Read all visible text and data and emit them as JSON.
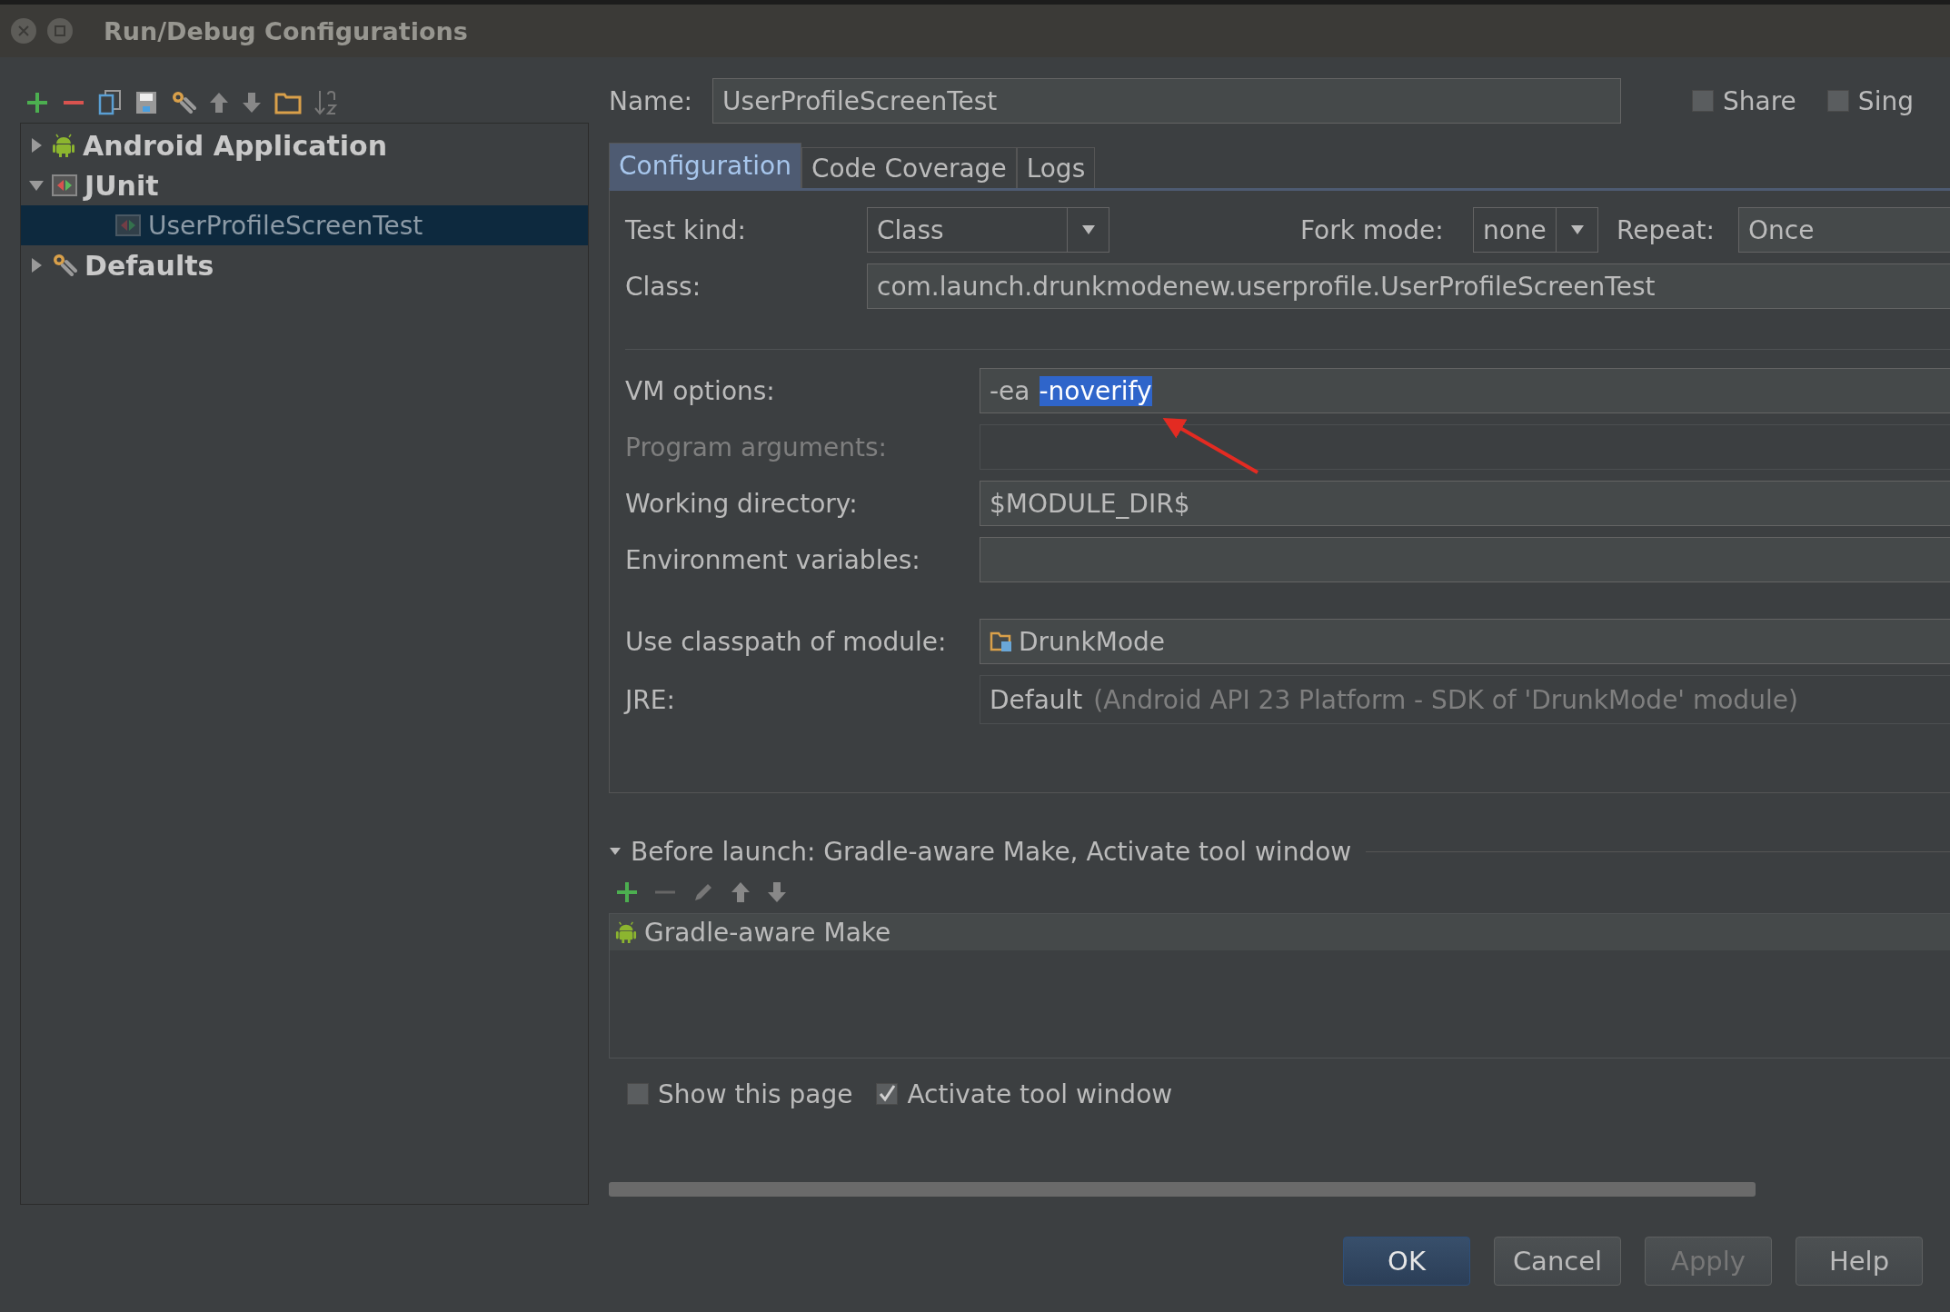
{
  "window": {
    "title": "Run/Debug Configurations"
  },
  "tree": [
    {
      "label": "Android Application",
      "kind": "android",
      "expanded": false,
      "selected": false
    },
    {
      "label": "JUnit",
      "kind": "junit",
      "expanded": true,
      "selected": false,
      "children": [
        {
          "label": "UserProfileScreenTest",
          "kind": "test",
          "selected": true
        }
      ]
    },
    {
      "label": "Defaults",
      "kind": "defaults",
      "expanded": false,
      "selected": false
    }
  ],
  "name_field": {
    "label": "Name:",
    "value": "UserProfileScreenTest"
  },
  "header_checkboxes": [
    {
      "label": "Share",
      "checked": false
    },
    {
      "label": "Sing",
      "checked": false
    }
  ],
  "tabs": [
    {
      "label": "Configuration",
      "selected": true
    },
    {
      "label": "Code Coverage",
      "selected": false
    },
    {
      "label": "Logs",
      "selected": false
    }
  ],
  "test_kind": {
    "label": "Test kind:",
    "value": "Class"
  },
  "fork_mode": {
    "label": "Fork mode:",
    "value": "none"
  },
  "repeat": {
    "label": "Repeat:",
    "value": "Once"
  },
  "class_field": {
    "label": "Class:",
    "value": "com.launch.drunkmodenew.userprofile.UserProfileScreenTest"
  },
  "options": [
    {
      "label": "VM options:",
      "value": "-ea",
      "selected_text": "-noverify",
      "disabled": false
    },
    {
      "label": "Program arguments:",
      "disabled": true
    },
    {
      "label": "Working directory:",
      "value": "$MODULE_DIR$",
      "disabled": false
    },
    {
      "label": "Environment variables:",
      "disabled": false
    }
  ],
  "classpath": {
    "label": "Use classpath of module:",
    "value": "DrunkMode"
  },
  "jre": {
    "label": "JRE:",
    "value": "Default",
    "hint": "(Android API 23 Platform - SDK of 'DrunkMode' module)"
  },
  "before_launch": {
    "title": "Before launch: Gradle-aware Make, Activate tool window",
    "expanded": true,
    "tasks": [
      {
        "label": "Gradle-aware Make",
        "selected": true
      }
    ]
  },
  "footer_checkboxes": [
    {
      "label": "Show this page",
      "checked": false
    },
    {
      "label": "Activate tool window",
      "checked": true
    }
  ],
  "buttons": [
    {
      "label": "OK",
      "default": true,
      "disabled": false
    },
    {
      "label": "Cancel",
      "default": false,
      "disabled": false
    },
    {
      "label": "Apply",
      "default": false,
      "disabled": true
    },
    {
      "label": "Help",
      "default": false,
      "disabled": false
    }
  ]
}
